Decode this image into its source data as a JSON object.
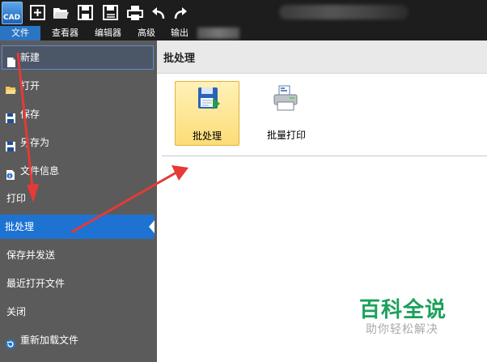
{
  "app": {
    "logo_text": "CAD"
  },
  "toolbar": {
    "buttons": [
      "new-file-icon",
      "open-folder-icon",
      "save-icon",
      "save-as-icon",
      "print-icon",
      "undo-icon",
      "redo-icon"
    ]
  },
  "menu": {
    "items": [
      {
        "label": "文件",
        "active": true
      },
      {
        "label": "查看器"
      },
      {
        "label": "编辑器"
      },
      {
        "label": "高级"
      },
      {
        "label": "输出"
      }
    ]
  },
  "sidebar": {
    "items": [
      {
        "label": "新建",
        "icon": "new-document-icon"
      },
      {
        "label": "打开",
        "icon": "open-folder-icon"
      },
      {
        "label": "保存",
        "icon": "save-icon"
      },
      {
        "label": "另存为",
        "icon": "save-as-icon"
      },
      {
        "label": "文件信息",
        "icon": "file-info-icon"
      },
      {
        "label": "打印"
      },
      {
        "label": "批处理",
        "selected": true
      },
      {
        "label": "保存并发送"
      },
      {
        "label": "最近打开文件"
      },
      {
        "label": "关闭"
      },
      {
        "label": "重新加载文件",
        "icon": "reload-icon"
      }
    ]
  },
  "panel": {
    "title": "批处理",
    "actions": [
      {
        "label": "批处理",
        "icon": "batch-process-icon",
        "selected": true
      },
      {
        "label": "批量打印",
        "icon": "batch-print-icon"
      }
    ]
  },
  "watermark": {
    "title": "百科全说",
    "subtitle": "助你轻松解决"
  },
  "colors": {
    "accent": "#1e72d2",
    "sidebar": "#5b5b5b",
    "topbar": "#1d1d1d",
    "selection": "#fcdc77",
    "arrow": "#e53a35",
    "watermark": "#1aa05a"
  }
}
